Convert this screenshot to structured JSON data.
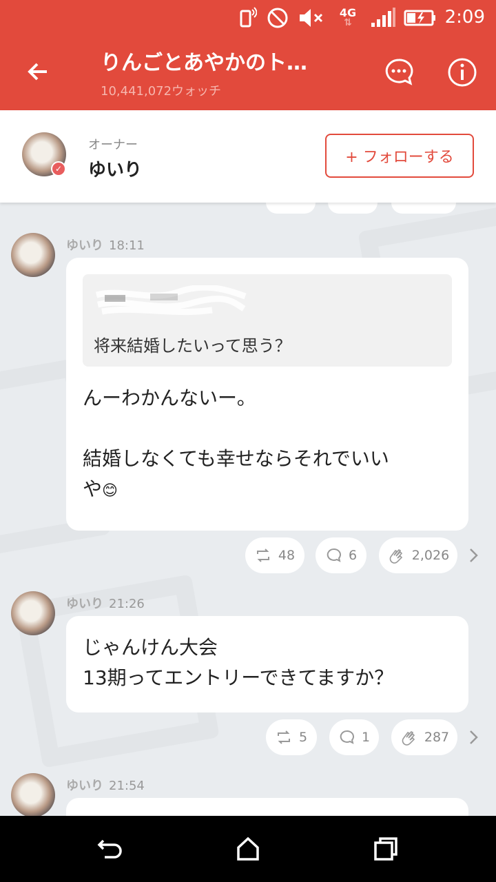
{
  "status_bar": {
    "time": "2:09",
    "network": "4G",
    "icons": [
      "vibrate-icon",
      "do-not-disturb-icon",
      "mute-icon",
      "4g-icon",
      "signal-icon",
      "battery-charging-icon"
    ]
  },
  "header": {
    "title": "りんごとあやかのト…",
    "watch_count": "10,441,072ウォッチ",
    "icons": [
      "back-arrow-icon",
      "chat-bubble-icon",
      "info-icon"
    ]
  },
  "owner": {
    "label": "オーナー",
    "name": "ゆいり",
    "follow_label": "+ フォローする"
  },
  "posts": [
    {
      "author": "ゆいり",
      "time": "18:11",
      "quote_text": "将来結婚したいって思う？",
      "message": "んーわかんないー。\n\n結婚しなくても幸せならそれでいい\nや",
      "emoji": "😊",
      "reposts": "48",
      "comments": "6",
      "claps": "2,026"
    },
    {
      "author": "ゆいり",
      "time": "21:26",
      "message": "じゃんけん大会\n13期ってエントリーできてますか？",
      "reposts": "5",
      "comments": "1",
      "claps": "287"
    },
    {
      "author": "ゆいり",
      "time": "21:54"
    }
  ],
  "colors": {
    "brand_red": "#e24a3c",
    "background": "#e9ecef",
    "bubble": "#ffffff"
  },
  "navbar_icons": [
    "nav-back-icon",
    "nav-home-icon",
    "nav-recents-icon"
  ]
}
